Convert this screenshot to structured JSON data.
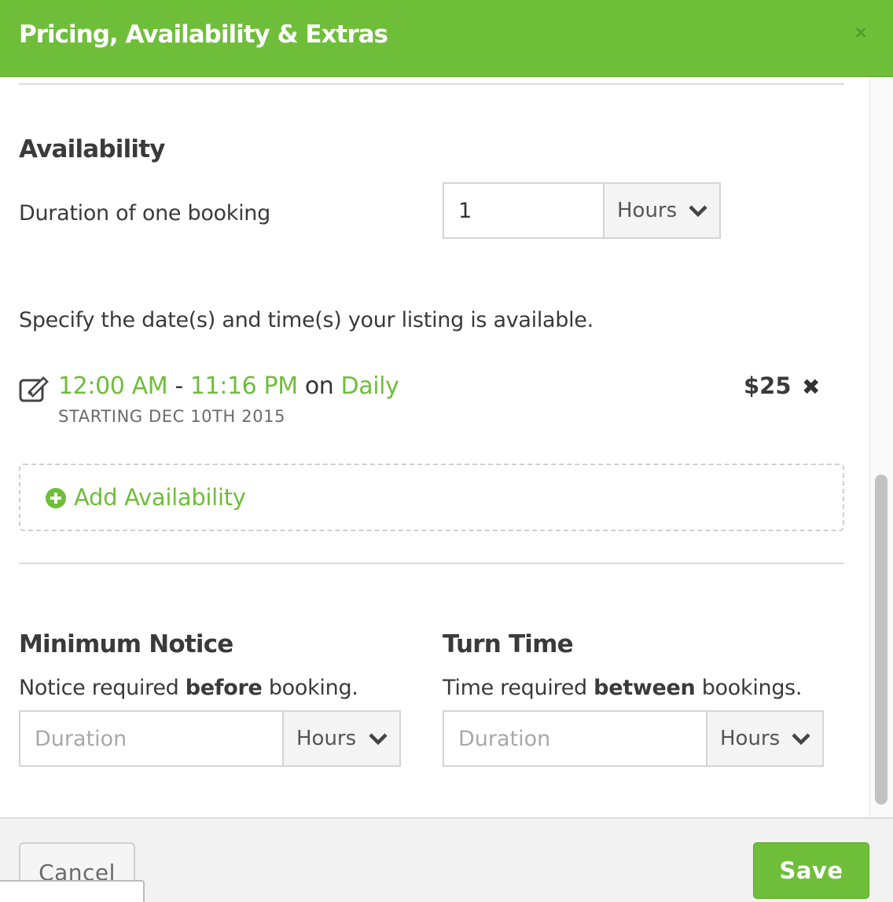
{
  "header": {
    "title": "Pricing, Availability & Extras",
    "close_glyph": "×",
    "color": "#6fbe3a"
  },
  "availability": {
    "title": "Availability",
    "duration_label": "Duration of one booking",
    "duration_value": "1",
    "duration_unit": "Hours",
    "specify_text": "Specify the date(s) and time(s) your listing is available.",
    "entry": {
      "start_time": "12:00 AM",
      "separator": " - ",
      "end_time": "11:16 PM",
      "on_word": " on ",
      "recurrence": "Daily",
      "starting": "STARTING DEC 10TH 2015",
      "price": "$25",
      "remove_glyph": "✖"
    },
    "add_label": "Add Availability"
  },
  "minimum_notice": {
    "title": "Minimum Notice",
    "desc_prefix": "Notice required ",
    "desc_bold": "before",
    "desc_suffix": " booking.",
    "placeholder": "Duration",
    "unit": "Hours"
  },
  "turn_time": {
    "title": "Turn Time",
    "desc_prefix": "Time required ",
    "desc_bold": "between",
    "desc_suffix": " bookings.",
    "placeholder": "Duration",
    "unit": "Hours"
  },
  "footer": {
    "cancel_label": "Cancel",
    "save_label": "Save"
  },
  "icons": {
    "edit": "edit-icon",
    "add": "plus-circle-icon",
    "chevron": "chevron-down-icon",
    "close": "close-icon"
  }
}
